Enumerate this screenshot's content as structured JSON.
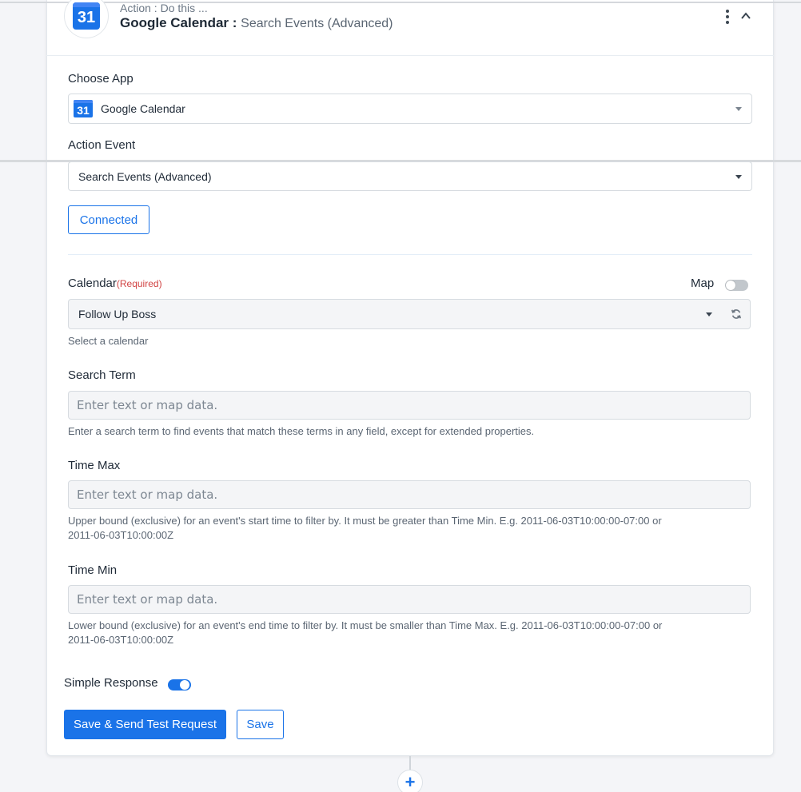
{
  "header": {
    "kicker": "Action : Do this ...",
    "app_name": "Google Calendar :",
    "event_name": "Search Events (Advanced)",
    "logo_text": "31"
  },
  "choose_app": {
    "label": "Choose App",
    "value": "Google Calendar",
    "logo_text": "31"
  },
  "action_event": {
    "label": "Action Event",
    "value": "Search Events (Advanced)"
  },
  "connected_label": "Connected",
  "calendar": {
    "label": "Calendar",
    "required": "(Required)",
    "map_label": "Map",
    "map_enabled": false,
    "value": "Follow Up Boss",
    "help": "Select a calendar"
  },
  "search_term": {
    "label": "Search Term",
    "placeholder": "Enter text or map data.",
    "help": "Enter a search term to find events that match these terms in any field, except for extended properties."
  },
  "time_max": {
    "label": "Time Max",
    "placeholder": "Enter text or map data.",
    "help_line1": "Upper bound (exclusive) for an event's start time to filter by. It must be greater than Time Min. E.g. 2011-06-03T10:00:00-07:00 or",
    "help_line2": "2011-06-03T10:00:00Z"
  },
  "time_min": {
    "label": "Time Min",
    "placeholder": "Enter text or map data.",
    "help_line1": "Lower bound (exclusive) for an event's end time to filter by. It must be smaller than Time Max. E.g. 2011-06-03T10:00:00-07:00 or",
    "help_line2": "2011-06-03T10:00:00Z"
  },
  "simple_response": {
    "label": "Simple Response",
    "enabled": true
  },
  "buttons": {
    "save_send": "Save & Send Test Request",
    "save": "Save"
  },
  "add_step_symbol": "+",
  "colors": {
    "accent": "#1a73e8",
    "required": "#d14343",
    "card_bg": "#ffffff",
    "page_bg": "#f4f5f8"
  }
}
